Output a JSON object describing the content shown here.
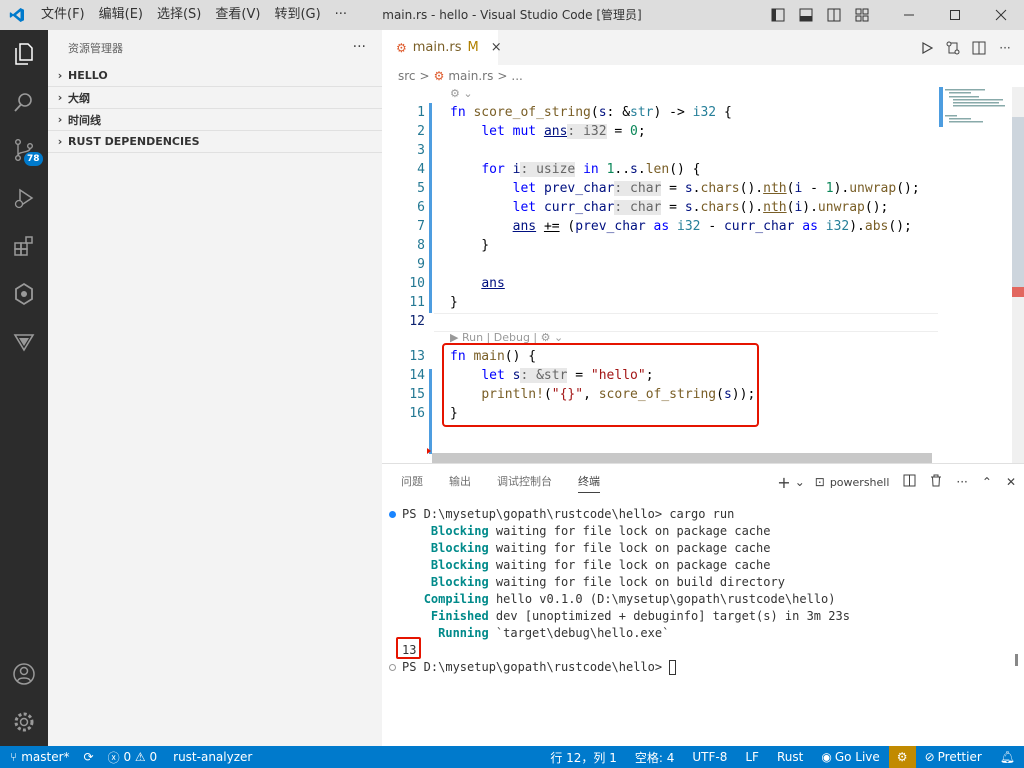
{
  "titlebar": {
    "title": "main.rs - hello - Visual Studio Code [管理员]",
    "menu": [
      "文件(F)",
      "编辑(E)",
      "选择(S)",
      "查看(V)",
      "转到(G)",
      "···"
    ]
  },
  "activity": {
    "scm_badge": "78"
  },
  "sidebar": {
    "title": "资源管理器",
    "more": "···",
    "sections": [
      "HELLO",
      "大纲",
      "时间线",
      "RUST DEPENDENCIES"
    ]
  },
  "editor": {
    "tab": {
      "name": "main.rs",
      "modified": "M",
      "close": "×"
    },
    "breadcrumbs": [
      "src",
      ">",
      "main.rs",
      ">",
      "..."
    ],
    "current_line": 12,
    "codelens": "Run | Debug |",
    "line_numbers": [
      1,
      2,
      3,
      4,
      5,
      6,
      7,
      8,
      9,
      10,
      11,
      12,
      13,
      14,
      15,
      16
    ]
  },
  "panel": {
    "tabs": [
      "问题",
      "输出",
      "调试控制台",
      "终端"
    ],
    "active_tab": "终端",
    "shell": "powershell",
    "terminal": {
      "prompt1": "PS D:\\mysetup\\gopath\\rustcode\\hello> ",
      "command": "cargo run",
      "lines": [
        {
          "tag": "Blocking",
          "text": " waiting for file lock on package cache",
          "indent": "    "
        },
        {
          "tag": "Blocking",
          "text": " waiting for file lock on package cache",
          "indent": "    "
        },
        {
          "tag": "Blocking",
          "text": " waiting for file lock on package cache",
          "indent": "    "
        },
        {
          "tag": "Blocking",
          "text": " waiting for file lock on build directory",
          "indent": "    "
        },
        {
          "tag": "Compiling",
          "text": " hello v0.1.0 (D:\\mysetup\\gopath\\rustcode\\hello)",
          "indent": "   "
        },
        {
          "tag": "Finished",
          "text": " dev [unoptimized + debuginfo] target(s) in 3m 23s",
          "indent": "    "
        },
        {
          "tag": "Running",
          "text": " `target\\debug\\hello.exe`",
          "indent": "     "
        }
      ],
      "output": "13",
      "prompt2": "PS D:\\mysetup\\gopath\\rustcode\\hello> "
    }
  },
  "statusbar": {
    "branch": "master*",
    "errors": "0",
    "warnings": "0",
    "analyzer": "rust-analyzer",
    "position": "行 12，列 1",
    "spaces": "空格: 4",
    "encoding": "UTF-8",
    "eol": "LF",
    "language": "Rust",
    "golive": "Go Live",
    "prettier": "Prettier"
  },
  "colors": {
    "accent": "#007acc",
    "highlight_box": "#e51400"
  }
}
